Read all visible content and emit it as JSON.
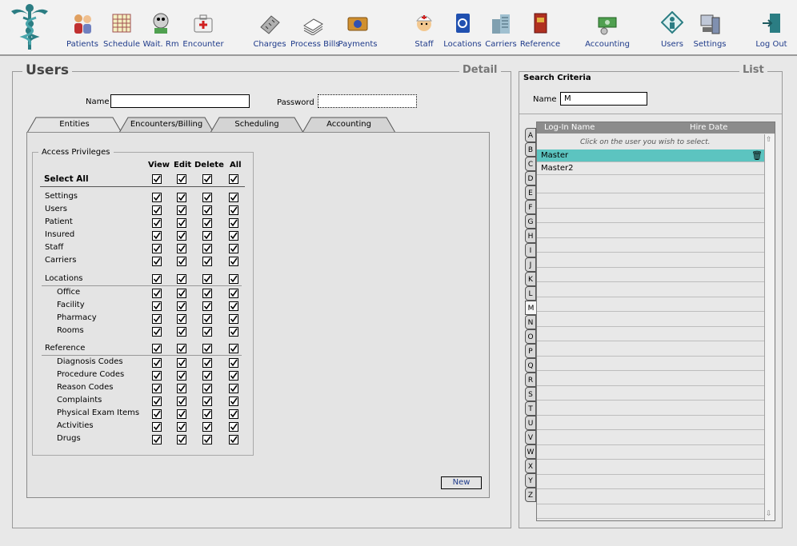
{
  "toolbar": {
    "items": [
      {
        "label": "Patients",
        "icon": "patients-icon"
      },
      {
        "label": "Schedule",
        "icon": "calendar-icon"
      },
      {
        "label": "Wait. Rm",
        "icon": "waiting-room-icon"
      },
      {
        "label": "Encounter",
        "icon": "medical-kit-icon"
      },
      {
        "label": "Charges",
        "icon": "calculator-icon"
      },
      {
        "label": "Process Bills",
        "icon": "paper-stack-icon"
      },
      {
        "label": "Payments",
        "icon": "payment-card-icon"
      },
      {
        "label": "Staff",
        "icon": "nurse-icon"
      },
      {
        "label": "Locations",
        "icon": "address-book-icon"
      },
      {
        "label": "Carriers",
        "icon": "building-icon"
      },
      {
        "label": "Reference",
        "icon": "reference-book-icon"
      },
      {
        "label": "Accounting",
        "icon": "money-icon"
      },
      {
        "label": "Users",
        "icon": "user-key-icon"
      },
      {
        "label": "Settings",
        "icon": "settings-computer-icon"
      },
      {
        "label": "Log Out",
        "icon": "exit-door-icon"
      }
    ]
  },
  "detail": {
    "title": "Users",
    "detail_label": "Detail",
    "name_label": "Name",
    "name_value": "",
    "password_label": "Password",
    "password_value": "",
    "tabs": [
      "Entities",
      "Encounters/Billing",
      "Scheduling",
      "Accounting"
    ],
    "active_tab": "Entities",
    "access_privileges_label": "Access Privileges",
    "columns": [
      "View",
      "Edit",
      "Delete",
      "All"
    ],
    "select_all_label": "Select All",
    "groups": [
      {
        "label": "",
        "rows": [
          {
            "label": "Settings",
            "indent": false
          },
          {
            "label": "Users",
            "indent": false
          },
          {
            "label": "Patient",
            "indent": false
          },
          {
            "label": "Insured",
            "indent": false
          },
          {
            "label": "Staff",
            "indent": false
          },
          {
            "label": "Carriers",
            "indent": false
          }
        ]
      },
      {
        "label": "Locations",
        "rows": [
          {
            "label": "Office",
            "indent": true
          },
          {
            "label": "Facility",
            "indent": true
          },
          {
            "label": "Pharmacy",
            "indent": true
          },
          {
            "label": "Rooms",
            "indent": true
          }
        ]
      },
      {
        "label": "Reference",
        "rows": [
          {
            "label": "Diagnosis Codes",
            "indent": true
          },
          {
            "label": "Procedure Codes",
            "indent": true
          },
          {
            "label": "Reason Codes",
            "indent": true
          },
          {
            "label": "Complaints",
            "indent": true
          },
          {
            "label": "Physical Exam Items",
            "indent": true
          },
          {
            "label": "Activities",
            "indent": true
          },
          {
            "label": "Drugs",
            "indent": true
          }
        ]
      }
    ],
    "new_button": "New"
  },
  "list": {
    "title": "List",
    "search_criteria_label": "Search Criteria",
    "name_label": "Name",
    "name_value": "M",
    "col_login": "Log-In Name",
    "col_hire": "Hire Date",
    "hint": "Click on the user you wish to select.",
    "letters": [
      "A",
      "B",
      "C",
      "D",
      "E",
      "F",
      "G",
      "H",
      "I",
      "J",
      "K",
      "L",
      "M",
      "N",
      "O",
      "P",
      "Q",
      "R",
      "S",
      "T",
      "U",
      "V",
      "W",
      "X",
      "Y",
      "Z"
    ],
    "active_letter": "M",
    "users": [
      {
        "name": "Master",
        "selected": true
      },
      {
        "name": "Master2",
        "selected": false
      }
    ],
    "empty_rows": 24
  },
  "colors": {
    "selected_row": "#5cc4c0",
    "link": "#1e3a8a",
    "header_bar": "#8c8c8c",
    "panel_bg": "#e8e8e8"
  }
}
